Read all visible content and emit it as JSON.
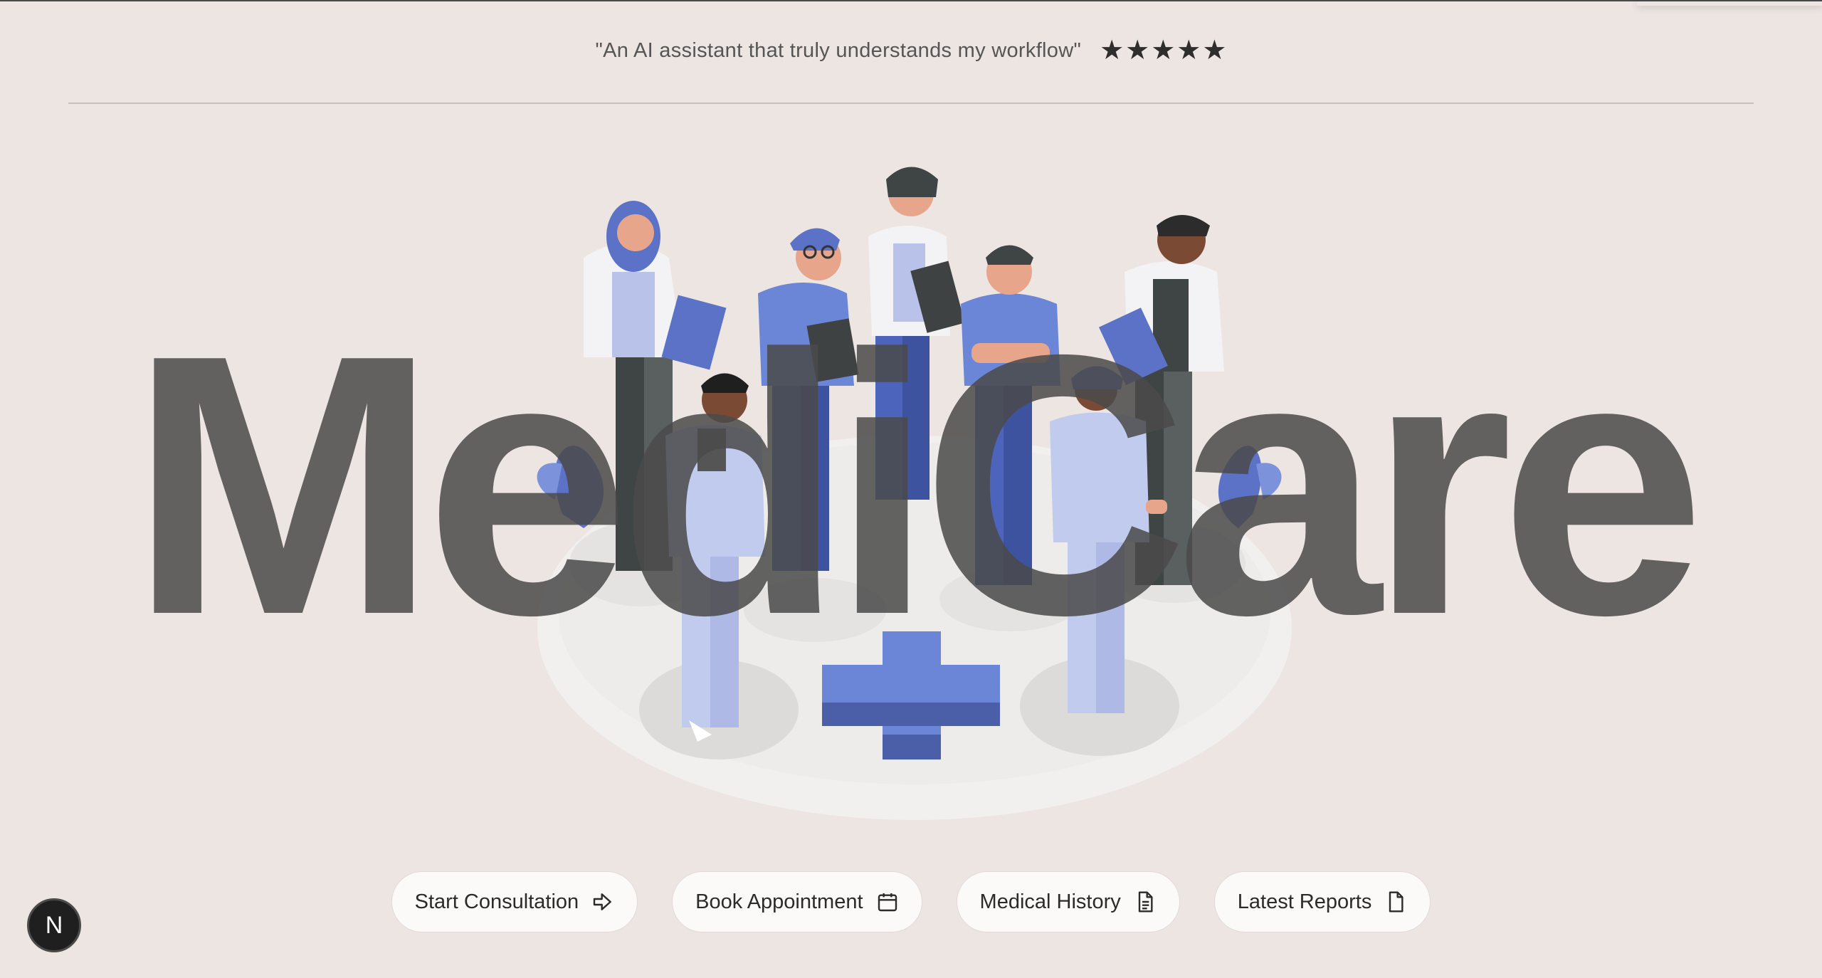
{
  "testimonial": {
    "quote": "\"An AI assistant that truly understands my workflow\"",
    "rating": 5,
    "stars": [
      "★",
      "★",
      "★",
      "★",
      "★"
    ]
  },
  "hero": {
    "brand": "MediCare",
    "illustration": "team-of-medical-professionals-with-medical-cross"
  },
  "actions": [
    {
      "label": "Start Consultation",
      "icon": "arrow-right-icon"
    },
    {
      "label": "Book Appointment",
      "icon": "calendar-icon"
    },
    {
      "label": "Medical History",
      "icon": "document-lines-icon"
    },
    {
      "label": "Latest Reports",
      "icon": "file-icon"
    }
  ],
  "avatar": {
    "initial": "N"
  },
  "colors": {
    "background": "#ede5e2",
    "accent_blue": "#6b86d6",
    "text_dark": "#2b2b2b"
  }
}
